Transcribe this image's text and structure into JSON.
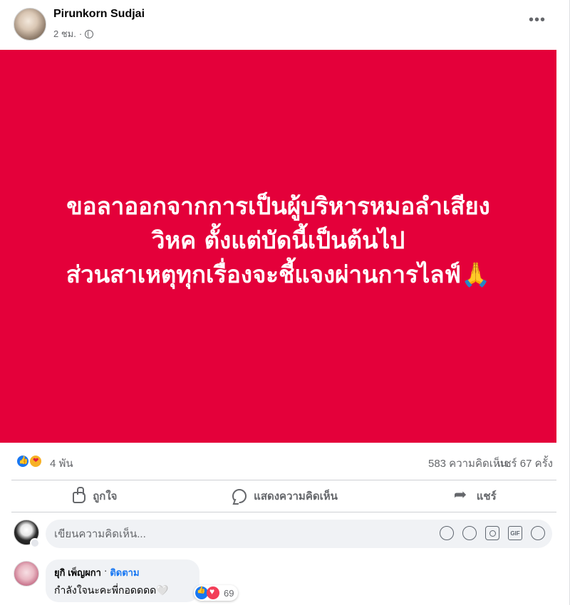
{
  "post": {
    "author": "Pirunkorn Sudjai",
    "time": "2 ชม.",
    "separator": "·",
    "more_label": "•••",
    "privacy_icon": "globe-icon",
    "lines": [
      "ขอลาออกจากการเป็นผู้บริหารหมอลำเสียง",
      "วิหค ตั้งแต่บัดนี้เป็นต้นไป",
      "ส่วนสาเหตุทุกเรื่องจะชี้แจงผ่านการไลฟ์🙏"
    ],
    "background_color": "#e4003a",
    "text_color": "#ffffff"
  },
  "summary": {
    "reactions_icons": [
      "like-reaction-icon",
      "care-reaction-icon"
    ],
    "reactions_count": "4 พัน",
    "comments_count": "583 ความคิดเห็น",
    "shares_count": "แชร์ 67 ครั้ง"
  },
  "actions": {
    "like_label": "ถูกใจ",
    "comment_label": "แสดงความคิดเห็น",
    "share_label": "แชร์"
  },
  "composer": {
    "placeholder": "เขียนความคิดเห็น...",
    "icons": [
      "avatar-sticker-icon",
      "emoji-icon",
      "camera-icon",
      "gif-icon",
      "sticker-icon"
    ],
    "gif_label": "GIF"
  },
  "comments": [
    {
      "name": "ยุกิ เพ็ญผกา",
      "separator": "·",
      "follow_label": "ติดตาม",
      "text": "กำลังใจนะคะพี่กอดดดด🤍",
      "reaction_count": "69"
    }
  ],
  "colors": {
    "accent": "#1877f2",
    "muted_text": "#65676b",
    "comment_bg": "#f0f2f5"
  }
}
